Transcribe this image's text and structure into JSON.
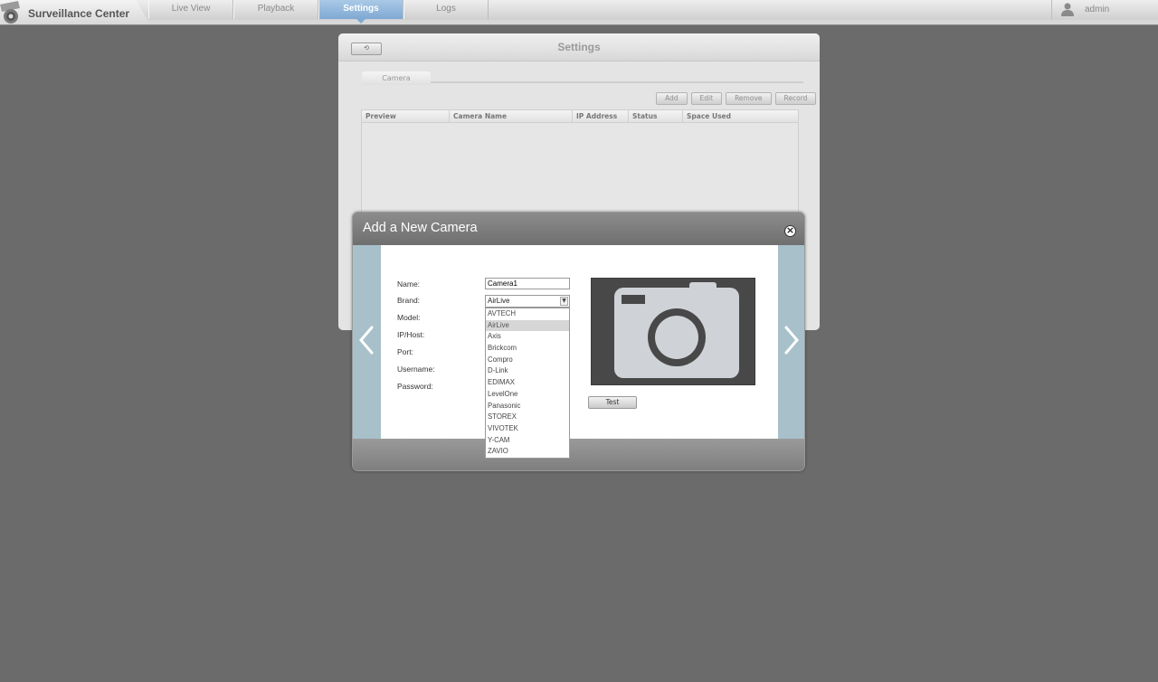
{
  "app": {
    "title": "Surveillance Center",
    "logo_icon": "camera-logo-icon"
  },
  "nav": {
    "tabs": [
      {
        "label": "Live View",
        "active": false
      },
      {
        "label": "Playback",
        "active": false
      },
      {
        "label": "Settings",
        "active": true
      },
      {
        "label": "Logs",
        "active": false
      }
    ],
    "active_color": "#7fa9d3"
  },
  "user": {
    "name": "admin",
    "icon": "user-icon"
  },
  "settings": {
    "title": "Settings",
    "back_label": "",
    "tab_label": "Camera",
    "toolbar": {
      "add": "Add",
      "edit": "Edit",
      "remove": "Remove",
      "record": "Record"
    },
    "columns": [
      "Preview",
      "Camera Name",
      "IP Address",
      "Status",
      "Space Used"
    ]
  },
  "modal": {
    "title": "Add a New Camera",
    "labels": {
      "name": "Name:",
      "brand": "Brand:",
      "model": "Model:",
      "ip_host": "IP/Host:",
      "port": "Port:",
      "username": "Username:",
      "password": "Password:"
    },
    "name_value": "Camera1",
    "brand_value": "AirLive",
    "brand_options": [
      "AVTECH",
      "AirLive",
      "Axis",
      "Brickcom",
      "Compro",
      "D-Link",
      "EDIMAX",
      "LevelOne",
      "Panasonic",
      "STOREX",
      "VIVOTEK",
      "Y-CAM",
      "ZAVIO"
    ],
    "brand_selected_index": 1,
    "test_label": "Test",
    "side_color": "#a8c0ca"
  }
}
